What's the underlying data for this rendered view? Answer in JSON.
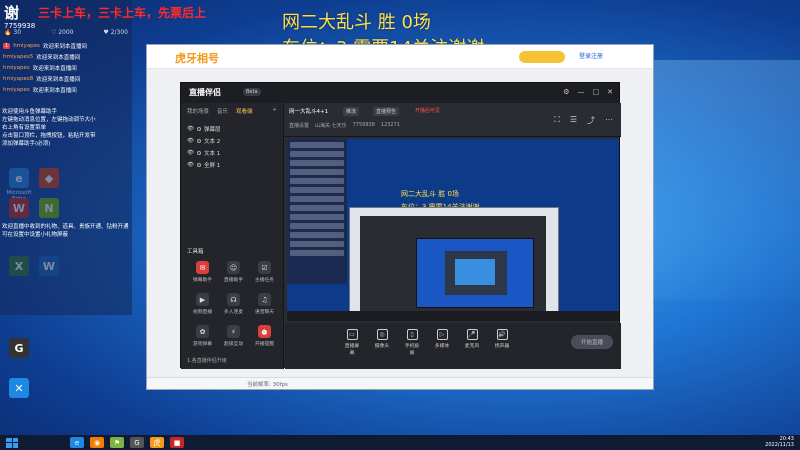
{
  "overlay": {
    "title": "谢",
    "promo": "三卡上车，三卡上车，先票后上",
    "count": "7759938",
    "stats": [
      "🔥 30",
      "♡ 2000",
      "♥ 2/300"
    ],
    "feed": [
      {
        "badge": "1",
        "user": "hmiyapes",
        "msg": "欢迎来到本直播间"
      },
      {
        "badge": "",
        "user": "hmiyapes5",
        "msg": "欢迎来到本直播间"
      },
      {
        "badge": "",
        "user": "hmiyapes",
        "msg": "欢迎来到本直播间"
      },
      {
        "badge": "",
        "user": "hmiyapes8",
        "msg": "欢迎来到本直播间"
      },
      {
        "badge": "",
        "user": "hmiyapes",
        "msg": "欢迎来到本直播间"
      }
    ],
    "notes": "欢迎使用斗鱼弹幕助手\n左键拖动消息位置，左键拖动调节大小\n右上角有设置菜单\n点击窗口顶栏，拖拽按钮，粘贴开发带\n添加弹幕助手(必须)",
    "notes2": "欢迎直播中收到的礼物、道具、贵族开通、钻粉开通\n可在设置中设置小礼物屏蔽"
  },
  "desktop_icons": [
    {
      "icon": "e-icon",
      "label": "Microsoft Edge",
      "glyph": "e",
      "color": "#1e88e5"
    },
    {
      "icon": "app-icon",
      "label": "",
      "glyph": "◆",
      "color": "#d84315"
    },
    {
      "icon": "wps-icon",
      "label": "",
      "glyph": "W",
      "color": "#c62828"
    },
    {
      "icon": "nvidia-icon",
      "label": "",
      "glyph": "N",
      "color": "#76b900"
    },
    {
      "icon": "excel-icon",
      "label": "",
      "glyph": "X",
      "color": "#2e7d32"
    },
    {
      "icon": "word-icon",
      "label": "",
      "glyph": "W",
      "color": "#1565c0"
    },
    {
      "icon": "game-icon",
      "label": "",
      "glyph": "G",
      "color": "#333"
    },
    {
      "icon": "tool-icon",
      "label": "",
      "glyph": "✕",
      "color": "#1e88e5"
    }
  ],
  "banner": {
    "line1": "网二大乱斗 胜 0场",
    "line2": "车位：3   需要14关注谢谢"
  },
  "huya": {
    "logo": "虎牙相号",
    "search_badge": "",
    "login": "登录注册",
    "bottom_text": "当前帧率: 30fps"
  },
  "zb": {
    "app": "直播伴侣",
    "version": "Beta",
    "tabs": [
      "我的场景",
      "音乐",
      "观看端"
    ],
    "active_tab": 2,
    "scenes": [
      "弹幕层",
      "文本 2",
      "文本 1",
      "全屏 1"
    ],
    "toolbox": "工具箱",
    "tools": [
      {
        "label": "弹幕助手",
        "red": true
      },
      {
        "label": "直播助手",
        "red": false
      },
      {
        "label": "主播任务",
        "red": false
      },
      {
        "label": "视频直播",
        "red": false
      },
      {
        "label": "多人连麦",
        "red": false
      },
      {
        "label": "语音聊天",
        "red": false
      },
      {
        "label": "游戏弹幕",
        "red": false
      },
      {
        "label": "超级互动",
        "red": false
      },
      {
        "label": "开播提醒",
        "red": true
      }
    ],
    "footer": "1.各直播伴侣升级",
    "room_name": "网一大乱斗4+1",
    "head_tags": [
      "推流",
      "直播预告"
    ],
    "head_red": "开播后可见",
    "head_sub": [
      "直播设置",
      "山海关·七天乐",
      "7759938",
      "123271"
    ],
    "bottom_buttons": [
      "直播屏幕",
      "摄像头",
      "手机投屏",
      "多媒体",
      "麦克风",
      "扬声器"
    ],
    "start": "开始直播"
  },
  "preview": {
    "line1": "网二大乱斗 胜 0场",
    "line2": "车位：3  需要14关注谢谢"
  },
  "taskbar": {
    "time": "20:43",
    "date": "2022/11/13",
    "apps": [
      {
        "glyph": "e",
        "color": "#1e88e5"
      },
      {
        "glyph": "◉",
        "color": "#f57c00"
      },
      {
        "glyph": "⚑",
        "color": "#7cb342"
      },
      {
        "glyph": "G",
        "color": "#555"
      },
      {
        "glyph": "虎",
        "color": "#f39a1b"
      },
      {
        "glyph": "■",
        "color": "#c62828"
      }
    ]
  }
}
